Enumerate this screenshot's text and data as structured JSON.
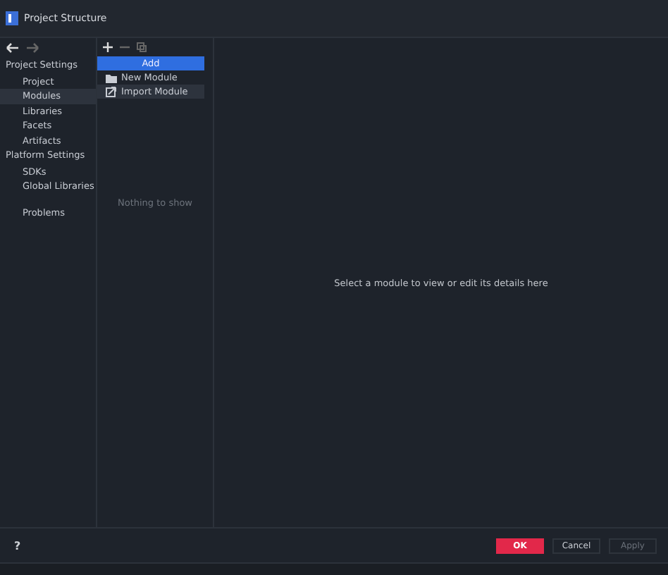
{
  "window": {
    "title": "Project Structure"
  },
  "sidebar": {
    "sections": [
      {
        "title": "Project Settings",
        "items": [
          {
            "label": "Project",
            "selected": false
          },
          {
            "label": "Modules",
            "selected": true
          },
          {
            "label": "Libraries",
            "selected": false
          },
          {
            "label": "Facets",
            "selected": false
          },
          {
            "label": "Artifacts",
            "selected": false
          }
        ]
      },
      {
        "title": "Platform Settings",
        "items": [
          {
            "label": "SDKs",
            "selected": false
          },
          {
            "label": "Global Libraries",
            "selected": false
          }
        ]
      },
      {
        "items": [
          {
            "label": "Problems",
            "selected": false
          }
        ]
      }
    ]
  },
  "add_menu": {
    "title": "Add",
    "items": [
      {
        "label": "New Module",
        "kind": "folder",
        "hovered": false
      },
      {
        "label": "Import Module",
        "kind": "import",
        "hovered": true
      }
    ]
  },
  "list_panel": {
    "empty_text": "Nothing to show"
  },
  "details": {
    "empty_text": "Select a module to view or edit its details here"
  },
  "footer": {
    "help": "?",
    "buttons": [
      {
        "label": "OK",
        "kind": "primary",
        "disabled": false
      },
      {
        "label": "Cancel",
        "kind": "normal",
        "disabled": false
      },
      {
        "label": "Apply",
        "kind": "normal",
        "disabled": true
      }
    ]
  }
}
